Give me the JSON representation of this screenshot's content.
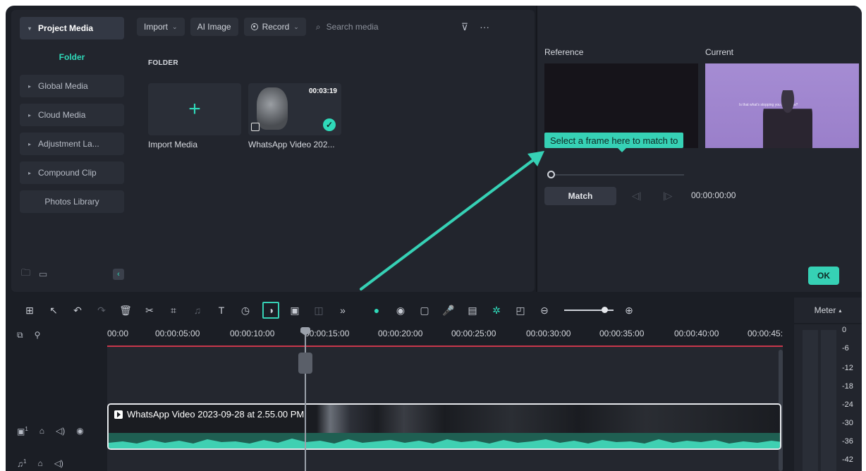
{
  "sidebar": {
    "header": "Project Media",
    "active": "Folder",
    "items": [
      {
        "label": "Global Media"
      },
      {
        "label": "Cloud Media"
      },
      {
        "label": "Adjustment La..."
      },
      {
        "label": "Compound Clip"
      },
      {
        "label": "Photos Library"
      }
    ]
  },
  "media_toolbar": {
    "import_label": "Import",
    "ai_image_label": "AI Image",
    "record_label": "Record",
    "search_placeholder": "Search media",
    "more": "···"
  },
  "folder_section": {
    "label": "FOLDER",
    "items": [
      {
        "name": "Import Media"
      },
      {
        "name": "WhatsApp Video 202...",
        "duration": "00:03:19"
      }
    ]
  },
  "color_match": {
    "reference_label": "Reference",
    "current_label": "Current",
    "tooltip": "Select a frame here to match to",
    "current_caption": "Is that what's stopping you right now?",
    "match_label": "Match",
    "timecode": "00:00:00:00",
    "ok_label": "OK"
  },
  "timeline": {
    "meter_label": "Meter",
    "ticks": [
      "00:00",
      "00:00:05:00",
      "00:00:10:00",
      "00:00:15:00",
      "00:00:20:00",
      "00:00:25:00",
      "00:00:30:00",
      "00:00:35:00",
      "00:00:40:00",
      "00:00:45:"
    ],
    "clip_title": "WhatsApp Video 2023-09-28 at 2.55.00 PM",
    "meter_levels": [
      "0",
      "-6",
      "-12",
      "-18",
      "-24",
      "-30",
      "-36",
      "-42"
    ],
    "video_track_number": "1",
    "audio_track_number": "1"
  },
  "colors": {
    "accent": "#36d1b5",
    "ruler_red": "#c8374b"
  }
}
